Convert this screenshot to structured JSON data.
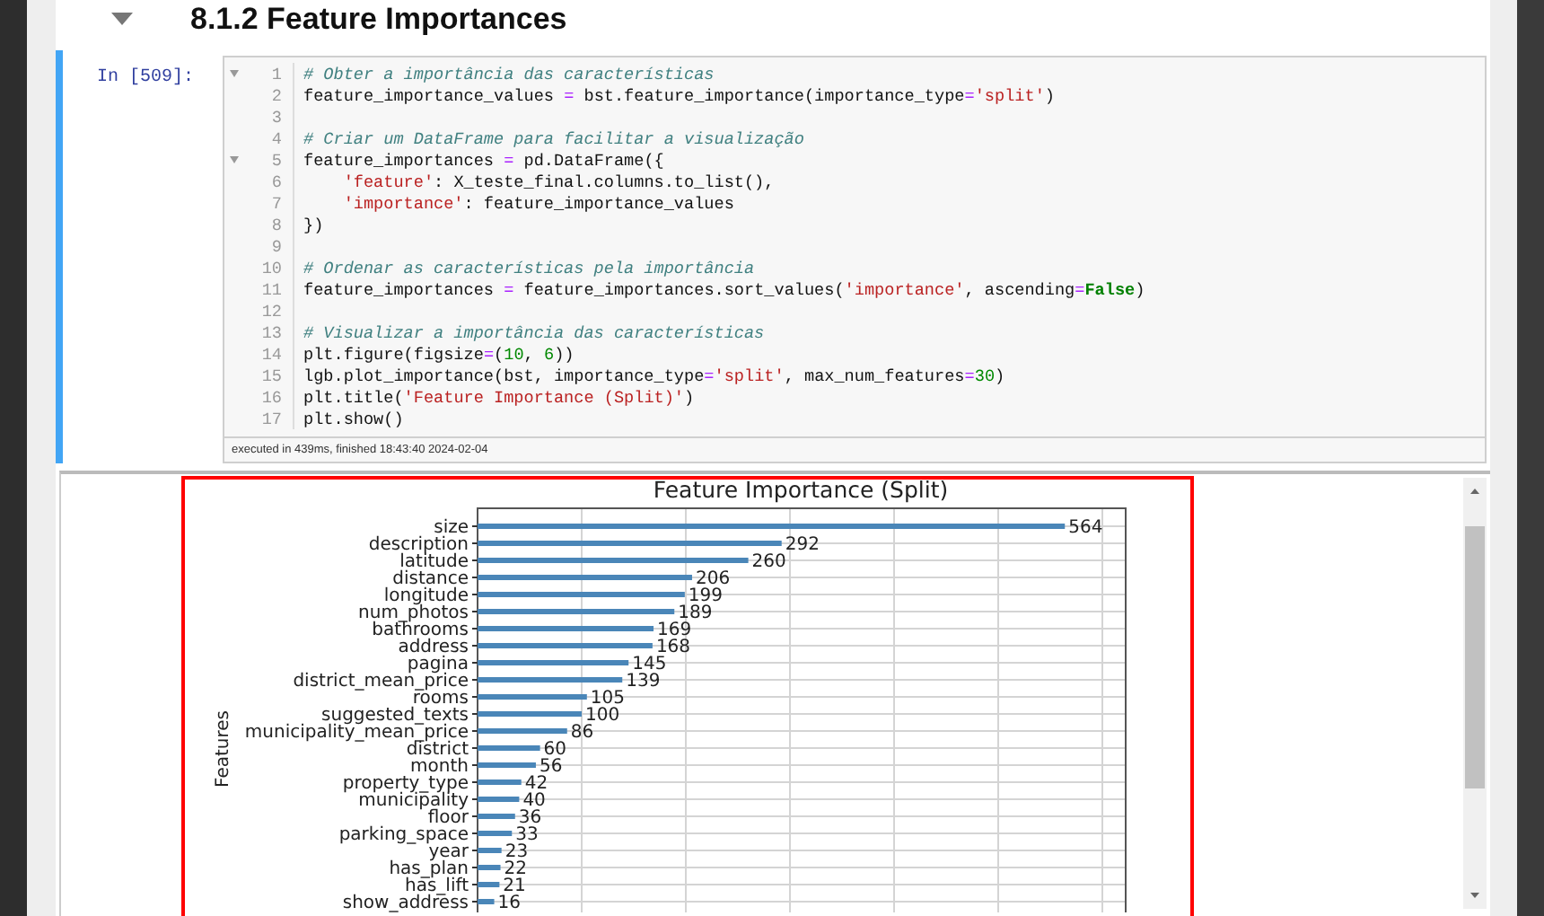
{
  "heading": {
    "text": "8.1.2 Feature Importances",
    "expanded": true
  },
  "cell": {
    "prompt": "In [509]:",
    "lines": [
      {
        "number": "1",
        "foldable": true,
        "tokens": [
          {
            "kind": "comment",
            "text": "# Obter a importância das características"
          }
        ]
      },
      {
        "number": "2",
        "foldable": false,
        "tokens": [
          {
            "kind": "plain",
            "text": "feature_importance_values "
          },
          {
            "kind": "operator",
            "text": "="
          },
          {
            "kind": "plain",
            "text": " bst.feature_importance(importance_type"
          },
          {
            "kind": "operator",
            "text": "="
          },
          {
            "kind": "string",
            "text": "'split'"
          },
          {
            "kind": "plain",
            "text": ")"
          }
        ]
      },
      {
        "number": "3",
        "foldable": false
      },
      {
        "number": "4",
        "foldable": false,
        "tokens": [
          {
            "kind": "comment",
            "text": "# Criar um DataFrame para facilitar a visualização"
          }
        ]
      },
      {
        "number": "5",
        "foldable": true,
        "tokens": [
          {
            "kind": "plain",
            "text": "feature_importances "
          },
          {
            "kind": "operator",
            "text": "="
          },
          {
            "kind": "plain",
            "text": " pd.DataFrame({"
          }
        ]
      },
      {
        "number": "6",
        "foldable": false,
        "tokens": [
          {
            "kind": "string",
            "text": "    'feature'"
          },
          {
            "kind": "plain",
            "text": ": X_teste_final.columns.to_list(),"
          }
        ]
      },
      {
        "number": "7",
        "foldable": false,
        "tokens": [
          {
            "kind": "string",
            "text": "    'importance'"
          },
          {
            "kind": "plain",
            "text": ": feature_importance_values"
          }
        ]
      },
      {
        "number": "8",
        "foldable": false,
        "tokens": [
          {
            "kind": "plain",
            "text": "})"
          }
        ]
      },
      {
        "number": "9",
        "foldable": false
      },
      {
        "number": "10",
        "foldable": false,
        "tokens": [
          {
            "kind": "comment",
            "text": "# Ordenar as características pela importância"
          }
        ]
      },
      {
        "number": "11",
        "foldable": false,
        "tokens": [
          {
            "kind": "plain",
            "text": "feature_importances "
          },
          {
            "kind": "operator",
            "text": "="
          },
          {
            "kind": "plain",
            "text": " feature_importances.sort_values("
          },
          {
            "kind": "string",
            "text": "'importance'"
          },
          {
            "kind": "plain",
            "text": ", ascending"
          },
          {
            "kind": "operator",
            "text": "="
          },
          {
            "kind": "keyword",
            "text": "False"
          },
          {
            "kind": "plain",
            "text": ")"
          }
        ]
      },
      {
        "number": "12",
        "foldable": false
      },
      {
        "number": "13",
        "foldable": false,
        "tokens": [
          {
            "kind": "comment",
            "text": "# Visualizar a importância das características"
          }
        ]
      },
      {
        "number": "14",
        "foldable": false,
        "tokens": [
          {
            "kind": "plain",
            "text": "plt.figure(figsize"
          },
          {
            "kind": "operator",
            "text": "="
          },
          {
            "kind": "plain",
            "text": "("
          },
          {
            "kind": "number",
            "text": "10"
          },
          {
            "kind": "plain",
            "text": ", "
          },
          {
            "kind": "number",
            "text": "6"
          },
          {
            "kind": "plain",
            "text": "))"
          }
        ]
      },
      {
        "number": "15",
        "foldable": false,
        "tokens": [
          {
            "kind": "plain",
            "text": "lgb.plot_importance(bst, importance_type"
          },
          {
            "kind": "operator",
            "text": "="
          },
          {
            "kind": "string",
            "text": "'split'"
          },
          {
            "kind": "plain",
            "text": ", max_num_features"
          },
          {
            "kind": "operator",
            "text": "="
          },
          {
            "kind": "number",
            "text": "30"
          },
          {
            "kind": "plain",
            "text": ")"
          }
        ]
      },
      {
        "number": "16",
        "foldable": false,
        "tokens": [
          {
            "kind": "plain",
            "text": "plt.title("
          },
          {
            "kind": "string",
            "text": "'Feature Importance (Split)'"
          },
          {
            "kind": "plain",
            "text": ")"
          }
        ]
      },
      {
        "number": "17",
        "foldable": false,
        "tokens": [
          {
            "kind": "plain",
            "text": "plt.show()"
          }
        ]
      }
    ],
    "execution_info": "executed in 439ms, finished 18:43:40 2024-02-04"
  },
  "output": {
    "chart_data": {
      "type": "bar",
      "orientation": "horizontal",
      "title": "Feature Importance (Split)",
      "ylabel": "Features",
      "data_labels": true,
      "grid": true,
      "categories": [
        "size",
        "description",
        "latitude",
        "distance",
        "longitude",
        "num_photos",
        "bathrooms",
        "address",
        "pagina",
        "district_mean_price",
        "rooms",
        "suggested_texts",
        "municipality_mean_price",
        "district",
        "month",
        "property_type",
        "municipality",
        "floor",
        "parking_space",
        "year",
        "has_plan",
        "has_lift",
        "show_address"
      ],
      "values": [
        564,
        292,
        260,
        206,
        199,
        189,
        169,
        168,
        145,
        139,
        105,
        100,
        86,
        60,
        56,
        42,
        40,
        36,
        33,
        23,
        22,
        21,
        16
      ]
    }
  }
}
